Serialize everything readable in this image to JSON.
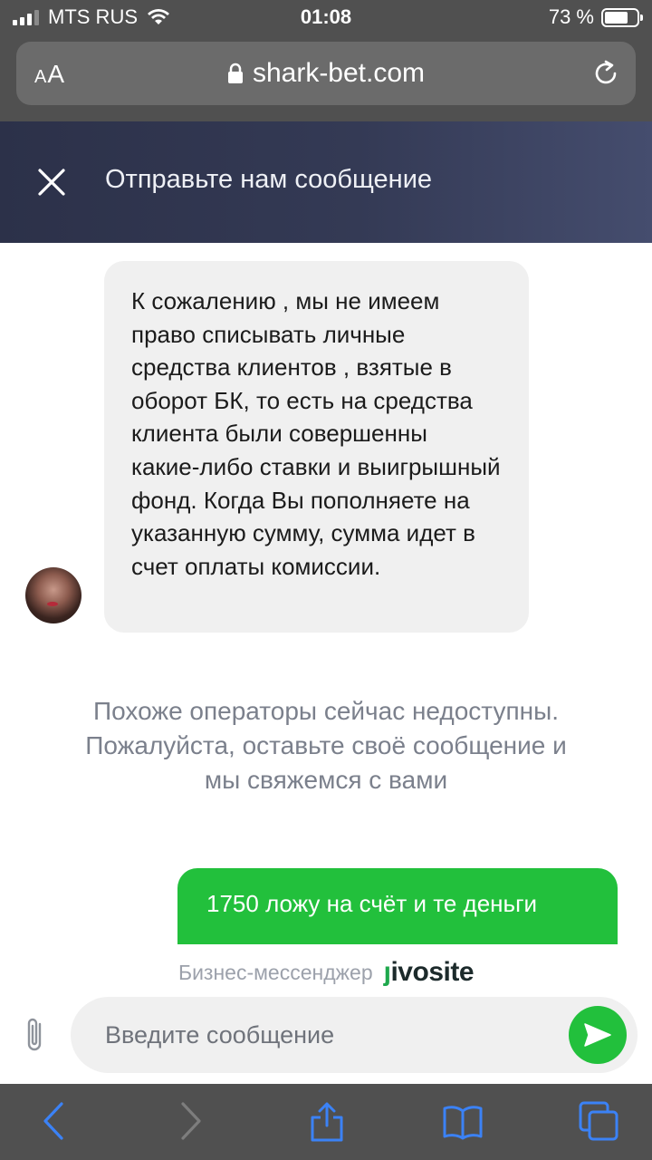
{
  "status_bar": {
    "carrier": "MTS RUS",
    "time": "01:08",
    "battery": "73 %",
    "battery_level": 0.73
  },
  "browser": {
    "text_size_label": "AA",
    "url": "shark-bet.com",
    "icons": [
      "lock-icon",
      "reload-icon"
    ]
  },
  "chat_header": {
    "title": "Отправьте нам сообщение"
  },
  "chat": {
    "operator_message": "К сожалению , мы не имеем право списывать личные средства клиентов , взятые в оборот БК, то есть на средства клиента были совершенны какие-либо ставки и выигрышный фонд. Когда Вы пополняете на указанную сумму, сумма идет в счет оплаты комиссии.",
    "system_message": "Похоже операторы сейчас недоступны. Пожалуйста, оставьте своё сообщение и мы свяжемся с вами",
    "user_message": "1750 ложу на счёт и те деньги"
  },
  "branding": {
    "label": "Бизнес-мессенджер",
    "logo": "jivosite"
  },
  "input": {
    "placeholder": "Введите сообщение"
  },
  "toolbar": {
    "icons": [
      "back-icon",
      "forward-icon",
      "share-icon",
      "bookmarks-icon",
      "tabs-icon"
    ]
  },
  "colors": {
    "accent_green": "#22c03c",
    "header_dark": "#2c3149",
    "chrome_gray": "#505050",
    "link_blue": "#3b82f6"
  }
}
